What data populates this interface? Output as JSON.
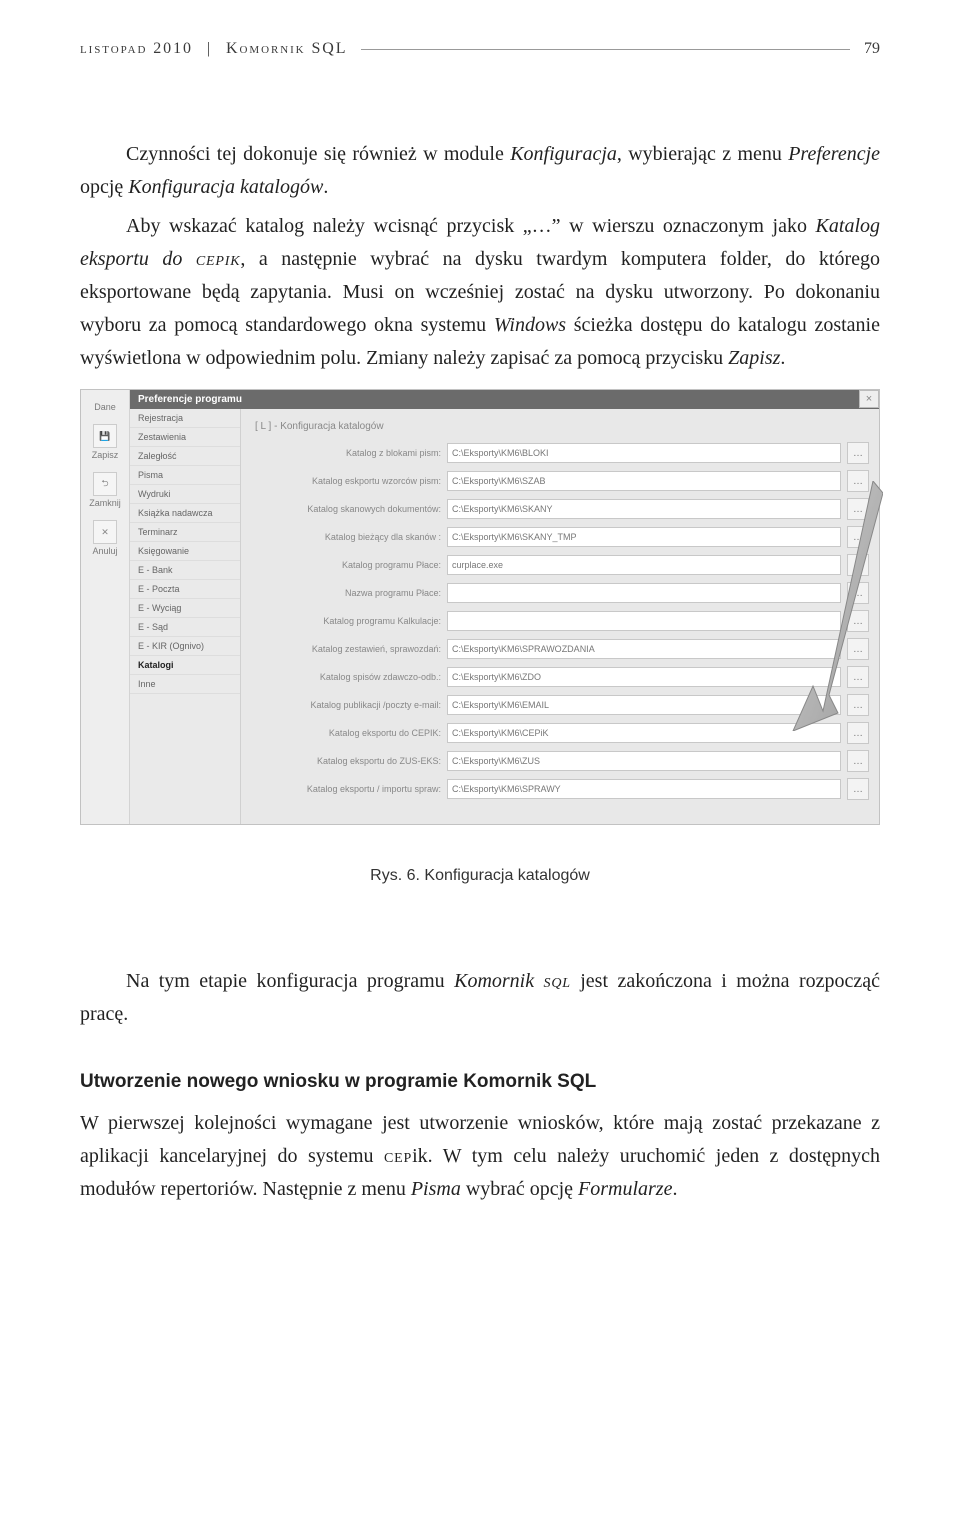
{
  "header": {
    "left": "listopad 2010",
    "sep": "|",
    "right_title": "Komornik SQL",
    "page_number": "79"
  },
  "para1_prefix": "Czynności tej dokonuje się również w module ",
  "para1_em1": "Konfiguracja",
  "para1_mid1": ", wybierając z menu ",
  "para1_em2": "Preferencje",
  "para1_mid2": " opcję ",
  "para1_em3": "Konfiguracja katalogów",
  "para1_suffix": ".",
  "para2_a": "Aby wskazać katalog należy wcisnąć przycisk „…” w wierszu oznaczonym jako ",
  "para2_em1": "Katalog eksportu do ",
  "para2_sc1": "cepik",
  "para2_b": ", a następnie wybrać na dysku twardym komputera folder, do którego eksportowane będą zapytania. Musi on wcześniej zostać na dysku utworzony. Po dokonaniu wyboru za pomocą standardowego okna systemu ",
  "para2_em2": "Windows",
  "para2_c": " ścieżka dostępu do katalogu zostanie wyświetlona w odpowiednim polu. Zmiany należy zapisać za pomocą przycisku ",
  "para2_em3": "Zapisz",
  "para2_d": ".",
  "caption": "Rys. 6. Konfiguracja katalogów",
  "para3_a": "Na tym etapie konfiguracja programu ",
  "para3_em1": "Komornik ",
  "para3_sc1": "sql",
  "para3_b": " jest zakończona i można rozpocząć pracę.",
  "subhead": "Utworzenie nowego wniosku w programie Komornik SQL",
  "para4_a": "W pierwszej kolejności wymagane jest utworzenie wniosków, które mają zostać przekazane z aplikacji kancelaryjnej do systemu ",
  "para4_sc1": "cep",
  "para4_after_sc": "ik. W tym celu należy uruchomić jeden z dostępnych modułów repertoriów. Następnie z menu ",
  "para4_em1": "Pisma",
  "para4_c": " wybrać opcję ",
  "para4_em2": "Formularze",
  "para4_d": ".",
  "ui": {
    "rail": {
      "items": [
        {
          "icon": "💾",
          "label": "Zapisz"
        },
        {
          "icon": "⮌",
          "label": "Zamknij"
        },
        {
          "icon": "✕",
          "label": "Anuluj"
        }
      ],
      "top_label": "Dane"
    },
    "sidebar": {
      "title": "Preferencje programu",
      "close": "×",
      "items": [
        "Rejestracja",
        "Zestawienia",
        "Zaległość",
        "Pisma",
        "Wydruki",
        "Książka nadawcza",
        "Terminarz",
        "Księgowanie",
        "E - Bank",
        "E - Poczta",
        "E - Wyciąg",
        "E - Sąd",
        "E - KIR (Ognivo)",
        "Katalogi",
        "Inne"
      ],
      "active_index": 13
    },
    "main": {
      "section_title": "[ L ] - Konfiguracja katalogów",
      "fields": [
        {
          "label": "Katalog z blokami pism:",
          "value": "C:\\Eksporty\\KM6\\BLOKI"
        },
        {
          "label": "Katalog eskportu wzorców pism:",
          "value": "C:\\Eksporty\\KM6\\SZAB"
        },
        {
          "label": "Katalog skanowych dokumentów:",
          "value": "C:\\Eksporty\\KM6\\SKANY"
        },
        {
          "label": "Katalog bieżący dla skanów :",
          "value": "C:\\Eksporty\\KM6\\SKANY_TMP"
        },
        {
          "label": "Katalog programu Płace:",
          "value": "curplace.exe"
        },
        {
          "label": "Nazwa programu Płace:",
          "value": ""
        },
        {
          "label": "Katalog programu Kalkulacje:",
          "value": ""
        },
        {
          "label": "Katalog zestawień, sprawozdań:",
          "value": "C:\\Eksporty\\KM6\\SPRAWOZDANIA"
        },
        {
          "label": "Katalog spisów zdawczo-odb.:",
          "value": "C:\\Eksporty\\KM6\\ZDO"
        },
        {
          "label": "Katalog publikacji /poczty e-mail:",
          "value": "C:\\Eksporty\\KM6\\EMAIL"
        },
        {
          "label": "Katalog eksportu do CEPIK:",
          "value": "C:\\Eksporty\\KM6\\CEPiK"
        },
        {
          "label": "Katalog eksportu do ZUS-EKS:",
          "value": "C:\\Eksporty\\KM6\\ZUS"
        },
        {
          "label": "Katalog eksportu / importu spraw:",
          "value": "C:\\Eksporty\\KM6\\SPRAWY"
        }
      ],
      "browse": "…"
    }
  }
}
